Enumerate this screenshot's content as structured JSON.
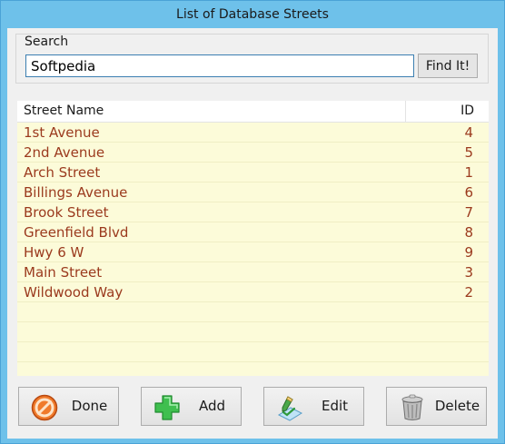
{
  "window": {
    "title": "List of Database Streets"
  },
  "search": {
    "label": "Search",
    "value": "Softpedia",
    "find_button": "Find It!"
  },
  "list": {
    "columns": [
      "Street Name",
      "ID"
    ],
    "rows": [
      {
        "name": "1st Avenue",
        "id": "4"
      },
      {
        "name": "2nd Avenue",
        "id": "5"
      },
      {
        "name": "Arch Street",
        "id": "1"
      },
      {
        "name": "Billings Avenue",
        "id": "6"
      },
      {
        "name": "Brook Street",
        "id": "7"
      },
      {
        "name": "Greenfield Blvd",
        "id": "8"
      },
      {
        "name": "Hwy 6 W",
        "id": "9"
      },
      {
        "name": "Main Street",
        "id": "3"
      },
      {
        "name": "Wildwood Way",
        "id": "2"
      }
    ]
  },
  "buttons": {
    "done": {
      "label": "Done",
      "icon": "no-entry-icon"
    },
    "add": {
      "label": "Add",
      "icon": "plus-icon"
    },
    "edit": {
      "label": "Edit",
      "icon": "pencil-check-icon"
    },
    "delete": {
      "label": "Delete",
      "icon": "trash-can-icon"
    }
  },
  "colors": {
    "titlebar": "#6ec1ea",
    "list_background": "#fcfbd9",
    "row_text": "#9b3a1e"
  }
}
